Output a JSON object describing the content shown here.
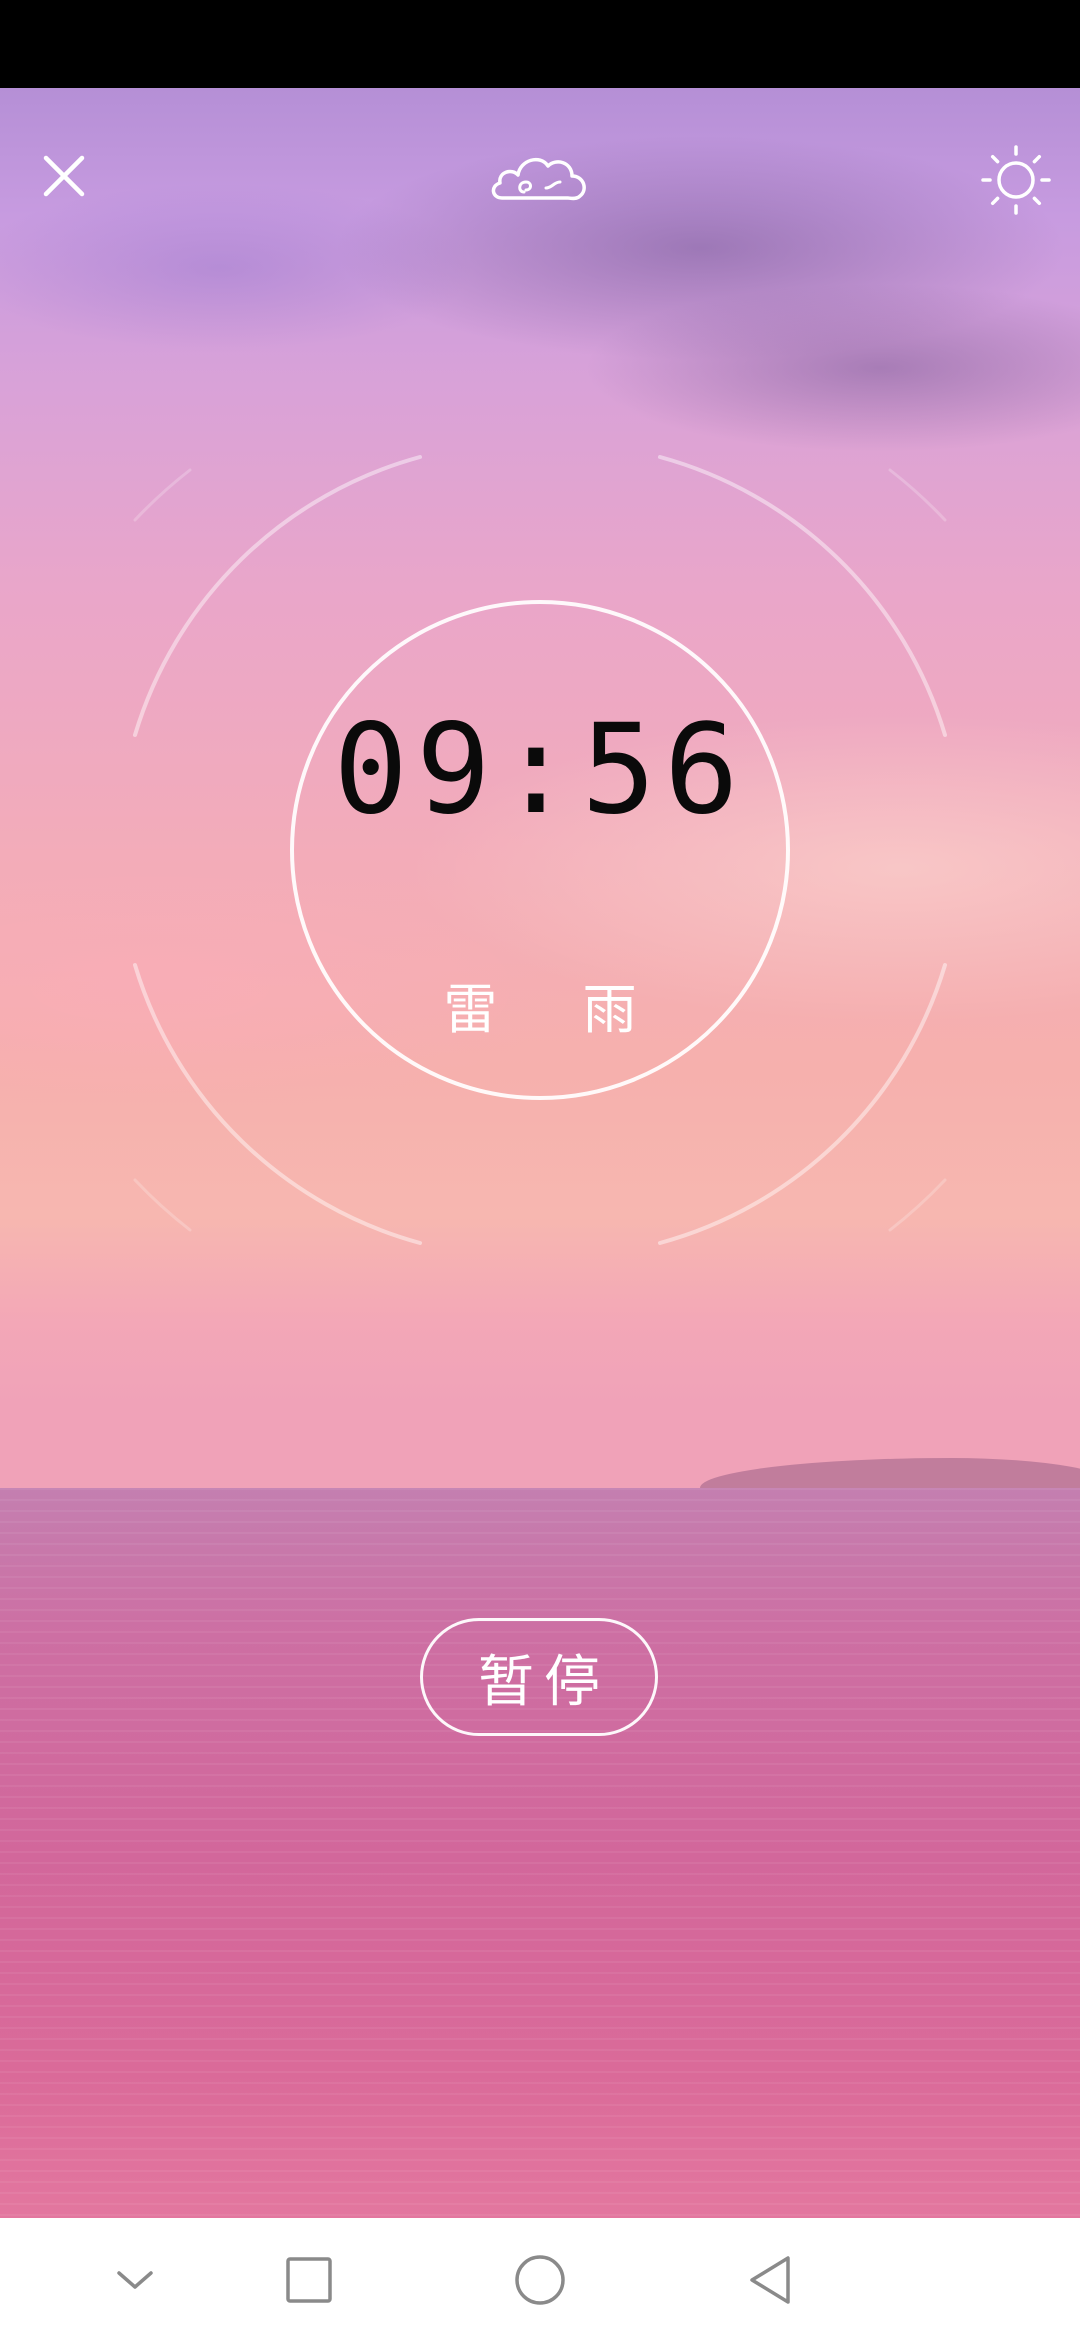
{
  "timer": {
    "remaining": "09:56",
    "sound_name": "雷 雨"
  },
  "controls": {
    "pause_label": "暂停"
  },
  "icons": {
    "close": "close-icon",
    "weather": "cloud-icon",
    "brightness": "sun-icon",
    "nav_down": "chevron-down-icon",
    "nav_recents": "square-icon",
    "nav_home": "circle-icon",
    "nav_back": "triangle-back-icon"
  },
  "colors": {
    "accent": "#ffffff",
    "time_text": "#0a0a0a",
    "nav_icon": "#8a8a8a"
  }
}
